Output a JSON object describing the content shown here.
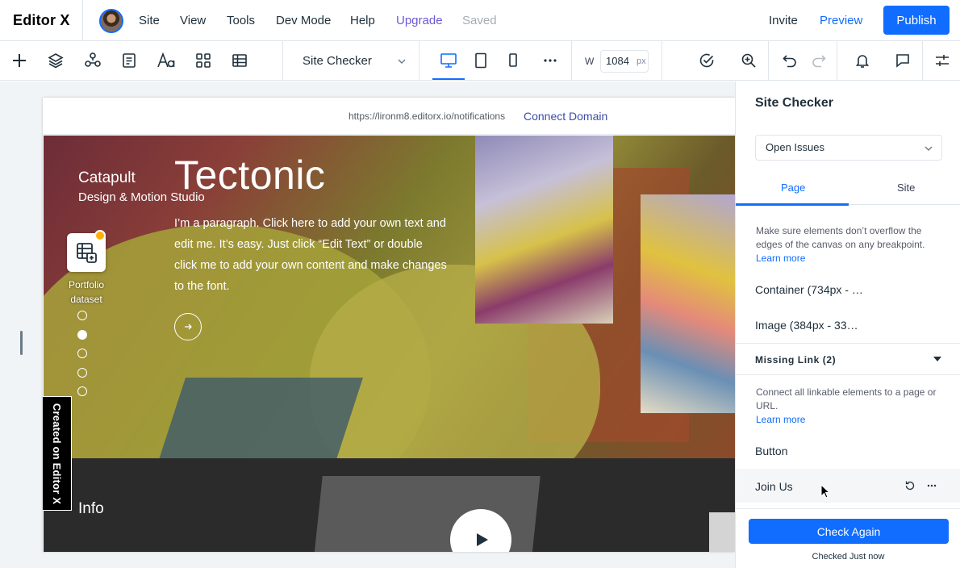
{
  "app": {
    "logo": "Editor X",
    "menu": [
      "Site",
      "View",
      "Tools",
      "Dev Mode",
      "Help"
    ],
    "upgrade": "Upgrade",
    "status": "Saved",
    "invite": "Invite",
    "preview": "Preview",
    "publish": "Publish",
    "colors": {
      "accent": "#116dff",
      "upgrade": "#6f56d9"
    }
  },
  "toolbar": {
    "left_icons": [
      "plus-icon",
      "layers-icon",
      "components-icon",
      "pages-icon",
      "typography-icon",
      "apps-icon",
      "cms-icon"
    ],
    "panel_select": "Site Checker",
    "breakpoints": [
      "desktop-icon",
      "tablet-icon",
      "mobile-icon",
      "more-icon"
    ],
    "active_breakpoint": "desktop",
    "width_label": "W",
    "width_value": "1084",
    "width_unit": "px"
  },
  "site": {
    "url": "https://lironm8.editorx.io/notifications",
    "connect_domain": "Connect Domain",
    "brand": "Catapult",
    "brand_sub": "Design & Motion Studio",
    "title": "Tectonic",
    "paragraph": "I’m a paragraph. Click here to add your own text and edit me. It’s easy. Just click “Edit Text” or double click me to add your own content and make changes to the font.",
    "dataset_label": "Portfolio dataset",
    "slider_dots": 5,
    "active_dot": 2,
    "info": "Info",
    "created_badge": "Created on Editor X"
  },
  "panel": {
    "title": "Site Checker",
    "filter": "Open Issues",
    "tabs": [
      "Page",
      "Site"
    ],
    "active_tab": "Page",
    "overflow_desc": "Make sure elements don’t overflow the edges of the canvas on any breakpoint.",
    "learn_more": "Learn more",
    "overflow_items": [
      "Container (734px - …",
      "Image (384px - 33…"
    ],
    "missing_link_header": "Missing Link (2)",
    "missing_link_desc": "Connect all linkable elements to a page or URL.",
    "missing_link_items": [
      "Button",
      "Join Us"
    ],
    "check_again": "Check Again",
    "checked_when": "Checked Just now"
  }
}
